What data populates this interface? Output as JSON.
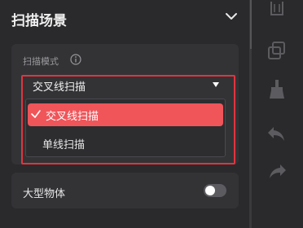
{
  "header": {
    "title": "扫描场景",
    "collapse_icon": "chevron-down-icon"
  },
  "scan_mode": {
    "label": "扫描模式",
    "info_icon": "info-icon",
    "current_value": "交叉线扫描",
    "options": [
      {
        "label": "交叉线扫描",
        "selected": true
      },
      {
        "label": "单线扫描",
        "selected": false
      }
    ]
  },
  "large_object": {
    "label": "大型物体",
    "enabled": false
  },
  "toolbar": {
    "tools": [
      "trash-icon",
      "duplicate-icon",
      "broom-icon",
      "undo-icon",
      "redo-icon"
    ]
  },
  "colors": {
    "accent": "#f0555a",
    "highlight_frame": "#e0353f",
    "background": "#2a2a2c",
    "card": "#333336"
  }
}
